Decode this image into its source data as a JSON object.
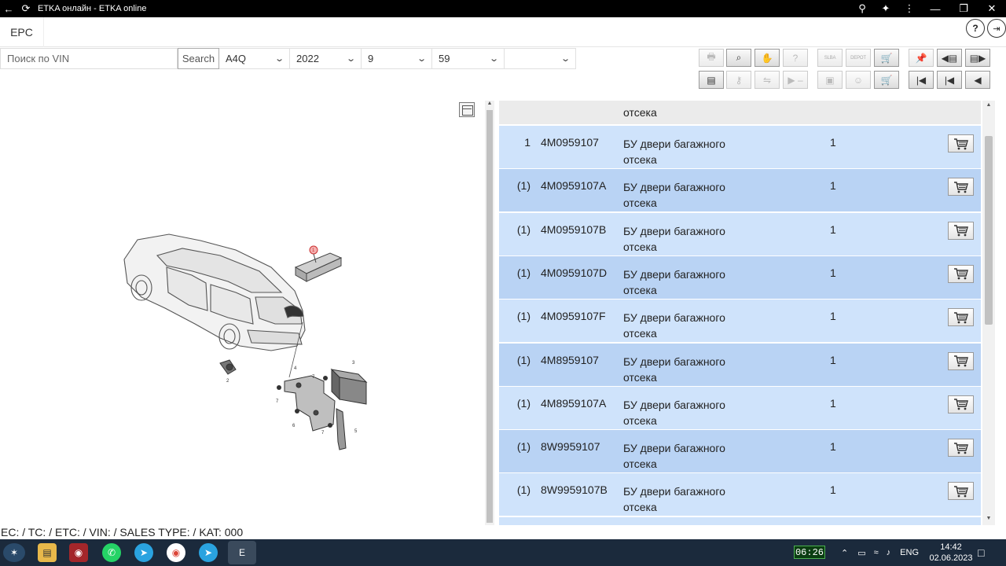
{
  "window": {
    "title": "ETKA онлайн - ETKA online"
  },
  "app": {
    "tab": "EPC",
    "help_label": "?",
    "exit_label": "⇥"
  },
  "filters": {
    "vin_placeholder": "Поиск по VIN",
    "search_label": "Search",
    "model": "A4Q",
    "year": "2022",
    "group": "9",
    "subgroup": "59",
    "extra": ""
  },
  "toolbar": {
    "row1": [
      {
        "name": "print-icon",
        "glyph": "🖶",
        "enabled": false
      },
      {
        "name": "search-catalog-icon",
        "glyph": "⌕",
        "enabled": true
      },
      {
        "name": "handshake-icon",
        "glyph": "✋",
        "enabled": true
      },
      {
        "name": "question-icon",
        "glyph": "?",
        "enabled": false
      },
      {
        "name": "slba-icon",
        "glyph": "SLBA",
        "enabled": false
      },
      {
        "name": "depot-icon",
        "glyph": "DEPOT",
        "enabled": false
      },
      {
        "name": "cart-arrow-icon",
        "glyph": "🛒",
        "enabled": true
      },
      {
        "name": "pin-icon",
        "glyph": "📌",
        "enabled": false
      },
      {
        "name": "prev-page-icon",
        "glyph": "◀▤",
        "enabled": true
      },
      {
        "name": "next-page-icon",
        "glyph": "▤▶",
        "enabled": true
      }
    ],
    "row2": [
      {
        "name": "list-icon",
        "glyph": "▤",
        "enabled": true
      },
      {
        "name": "key-icon",
        "glyph": "⚷",
        "enabled": false
      },
      {
        "name": "car-compare-icon",
        "glyph": "⇋",
        "enabled": false
      },
      {
        "name": "minus-icon",
        "glyph": "▶ –",
        "enabled": false
      },
      {
        "name": "document-icon",
        "glyph": "▣",
        "enabled": false
      },
      {
        "name": "person-icon",
        "glyph": "☺",
        "enabled": false
      },
      {
        "name": "cart-icon",
        "glyph": "🛒",
        "enabled": true
      },
      {
        "name": "first-page-icon",
        "glyph": "|◀",
        "enabled": true
      },
      {
        "name": "prev-icon",
        "glyph": "|◀",
        "enabled": true
      },
      {
        "name": "back-icon",
        "glyph": "◀",
        "enabled": true
      }
    ]
  },
  "parts": {
    "top_partial": {
      "description_line2": "отсека"
    },
    "rows": [
      {
        "pos": "1",
        "number": "4M0959107",
        "desc1": "БУ двери багажного",
        "desc2": "отсека",
        "qty": "1"
      },
      {
        "pos": "(1)",
        "number": "4M0959107A",
        "desc1": "БУ двери багажного",
        "desc2": "отсека",
        "qty": "1"
      },
      {
        "pos": "(1)",
        "number": "4M0959107B",
        "desc1": "БУ двери багажного",
        "desc2": "отсека",
        "qty": "1"
      },
      {
        "pos": "(1)",
        "number": "4M0959107D",
        "desc1": "БУ двери багажного",
        "desc2": "отсека",
        "qty": "1"
      },
      {
        "pos": "(1)",
        "number": "4M0959107F",
        "desc1": "БУ двери багажного",
        "desc2": "отсека",
        "qty": "1"
      },
      {
        "pos": "(1)",
        "number": "4M8959107",
        "desc1": "БУ двери багажного",
        "desc2": "отсека",
        "qty": "1"
      },
      {
        "pos": "(1)",
        "number": "4M8959107A",
        "desc1": "БУ двери багажного",
        "desc2": "отсека",
        "qty": "1"
      },
      {
        "pos": "(1)",
        "number": "8W9959107",
        "desc1": "БУ двери багажного",
        "desc2": "отсека",
        "qty": "1"
      },
      {
        "pos": "(1)",
        "number": "8W9959107B",
        "desc1": "БУ двери багажного",
        "desc2": "отсека",
        "qty": "1"
      }
    ]
  },
  "illustration": {
    "callouts": [
      "1",
      "2",
      "3",
      "4",
      "5",
      "6",
      "7",
      "7",
      "7"
    ]
  },
  "status": {
    "text": "EC: / TC: / ETC: / VIN: / SALES TYPE: / KAT: 000"
  },
  "taskbar": {
    "timer": "06:26",
    "lang": "ENG",
    "time": "14:42",
    "date": "02.06.2023"
  },
  "colors": {
    "row_blue": "#cfe3fb",
    "row_alt": "#b9d3f4",
    "taskbar": "#1b2a3c"
  }
}
